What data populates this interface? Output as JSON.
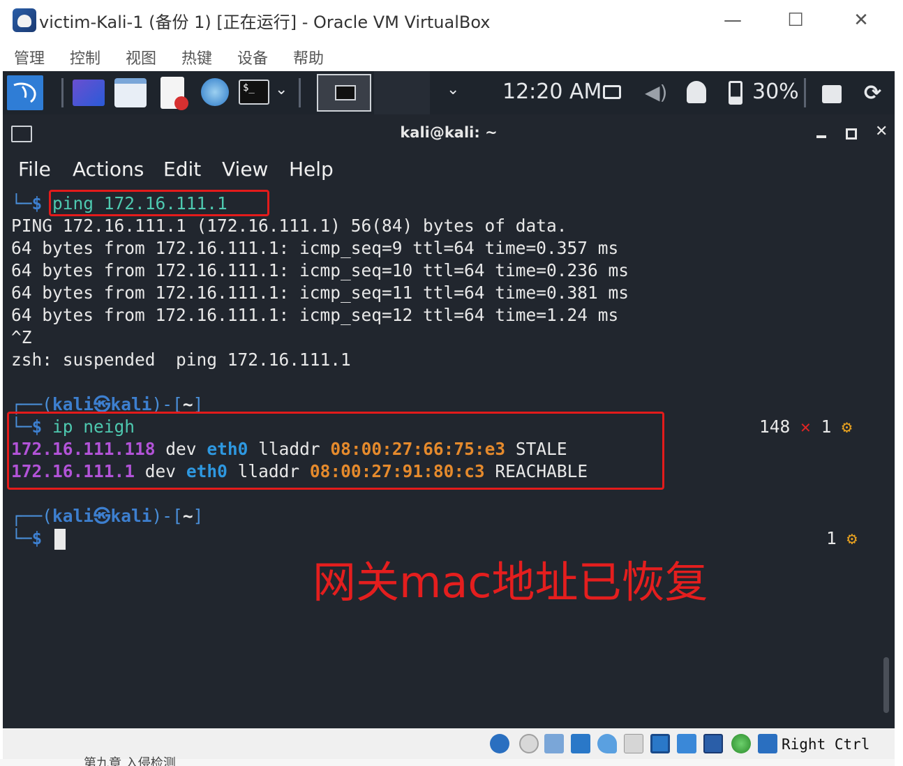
{
  "window": {
    "title": "victim-Kali-1 (备份 1) [正在运行] - Oracle VM VirtualBox",
    "minimize": "—",
    "maximize": "☐",
    "close": "✕"
  },
  "host_menu": [
    "管理",
    "控制",
    "视图",
    "热键",
    "设备",
    "帮助"
  ],
  "panel": {
    "clock": "12:20 AM",
    "battery": "30%"
  },
  "terminal": {
    "title": "kali@kali: ~",
    "menu": [
      "File",
      "Actions",
      "Edit",
      "View",
      "Help"
    ],
    "lines": {
      "prompt1_cmd": "ping 172.16.111.1",
      "ping_header": "PING 172.16.111.1 (172.16.111.1) 56(84) bytes of data.",
      "reply1": "64 bytes from 172.16.111.1: icmp_seq=9 ttl=64 time=0.357 ms",
      "reply2": "64 bytes from 172.16.111.1: icmp_seq=10 ttl=64 time=0.236 ms",
      "reply3": "64 bytes from 172.16.111.1: icmp_seq=11 ttl=64 time=0.381 ms",
      "reply4": "64 bytes from 172.16.111.1: icmp_seq=12 ttl=64 time=1.24 ms",
      "ctrl_z": "^Z",
      "suspended": "zsh: suspended  ping 172.16.111.1",
      "prompt_user": "kali",
      "prompt_at": "㉿",
      "prompt_host": "kali",
      "prompt_dir": "~",
      "cmd2": "ip neigh",
      "right_status_code": "148",
      "right_x": "✕",
      "right_jobs": "1",
      "right_jobs2": "1"
    },
    "neigh": [
      {
        "ip": "172.16.111.118",
        "dev_kw": "dev",
        "dev": "eth0",
        "ll_kw": "lladdr",
        "mac": "08:00:27:66:75:e3",
        "state": "STALE"
      },
      {
        "ip": "172.16.111.1",
        "dev_kw": "dev",
        "dev": "eth0",
        "ll_kw": "lladdr",
        "mac": "08:00:27:91:80:c3",
        "state": "REACHABLE"
      }
    ],
    "annotation": "网关mac地址已恢复"
  },
  "statusbar": {
    "host_key": "Right Ctrl"
  },
  "bottom_text": "第九章 入侵检测"
}
